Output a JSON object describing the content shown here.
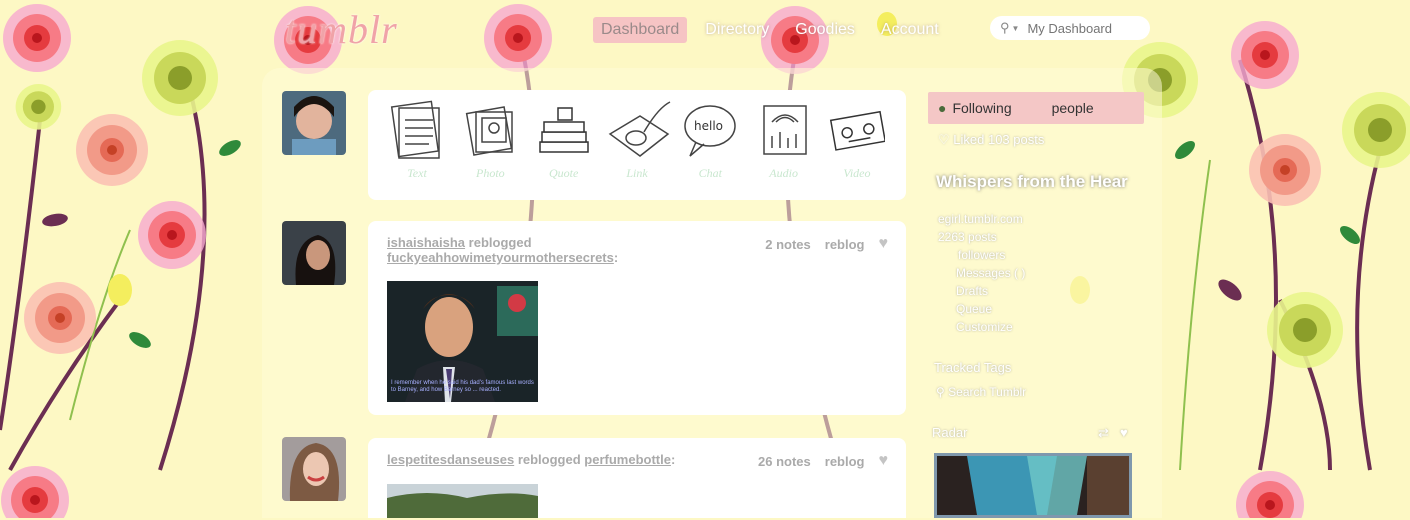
{
  "header": {
    "logo": "tumblr",
    "nav": [
      {
        "label": "Dashboard",
        "active": true
      },
      {
        "label": "Directory",
        "active": false
      },
      {
        "label": "Goodies",
        "active": false
      },
      {
        "label": "Account",
        "active": false
      }
    ],
    "search_placeholder": "My Dashboard"
  },
  "post_types": [
    {
      "label": "Text",
      "icon": "text-icon"
    },
    {
      "label": "Photo",
      "icon": "photo-icon"
    },
    {
      "label": "Quote",
      "icon": "quote-icon"
    },
    {
      "label": "Link",
      "icon": "link-icon"
    },
    {
      "label": "Chat",
      "icon": "chat-icon"
    },
    {
      "label": "Audio",
      "icon": "audio-icon"
    },
    {
      "label": "Video",
      "icon": "video-icon"
    }
  ],
  "posts": [
    {
      "user": "ishaishaisha",
      "action": "reblogged",
      "source": "fuckyeahhowimetyourmothersecrets",
      "notes": "2 notes",
      "reblog": "reblog",
      "caption": "I remember when he said his dad's famous last words to Barney, and how Barney so ... reacted."
    },
    {
      "user": "lespetitesdanseuses",
      "action": "reblogged",
      "source": "perfumebottle",
      "notes": "26 notes",
      "reblog": "reblog"
    }
  ],
  "sidebar": {
    "following_label": "Following",
    "following_suffix": "people",
    "liked": "Liked 103 posts",
    "blog_title": "Whispers from the Hear",
    "blog_url": "egirl.tumblr.com",
    "posts": "2263 posts",
    "followers": "followers",
    "messages": "Messages ( )",
    "drafts": "Drafts",
    "queue": "Queue",
    "customize": "Customize",
    "tracked_tags": "Tracked Tags",
    "search_tumblr": "Search Tumblr",
    "radar": "Radar"
  }
}
